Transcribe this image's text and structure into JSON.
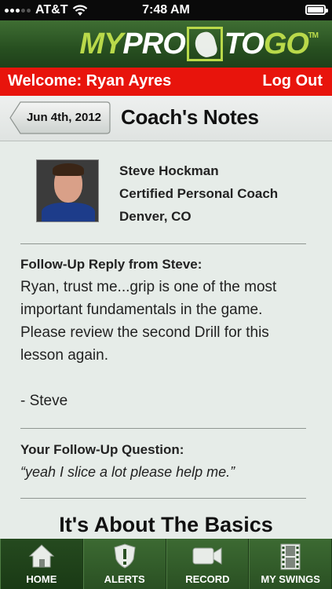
{
  "status_bar": {
    "carrier": "AT&T",
    "time": "7:48 AM",
    "battery_level": 1.0
  },
  "header": {
    "logo": {
      "part1": "MY",
      "part2": "PRO",
      "part3": "TO",
      "part4": "GO",
      "tm": "TM"
    }
  },
  "welcome_bar": {
    "welcome_text": "Welcome: Ryan Ayres",
    "logout_label": "Log Out"
  },
  "title_bar": {
    "back_label": "Jun 4th, 2012",
    "title": "Coach's Notes"
  },
  "coach": {
    "name": "Steve Hockman",
    "role": "Certified Personal Coach",
    "location": "Denver, CO"
  },
  "reply": {
    "heading": "Follow-Up Reply from Steve:",
    "lines": [
      "Ryan, trust me...grip is one of the most",
      "important fundamentals in the game.",
      "Please review the second Drill for this",
      "lesson again."
    ],
    "signature": "- Steve"
  },
  "question": {
    "heading": "Your Follow-Up Question:",
    "text": "“yeah I slice a lot please help me.”"
  },
  "lesson": {
    "title": "It's About The Basics"
  },
  "tabs": [
    {
      "label": "HOME",
      "icon": "home-icon",
      "active": true
    },
    {
      "label": "ALERTS",
      "icon": "alert-shield-icon",
      "active": false
    },
    {
      "label": "RECORD",
      "icon": "video-camera-icon",
      "active": false
    },
    {
      "label": "MY SWINGS",
      "icon": "film-strip-icon",
      "active": false
    }
  ],
  "colors": {
    "header_green": "#274f20",
    "welcome_red": "#e8140c",
    "logo_lime": "#b9d94a",
    "background": "#e6ece8"
  }
}
